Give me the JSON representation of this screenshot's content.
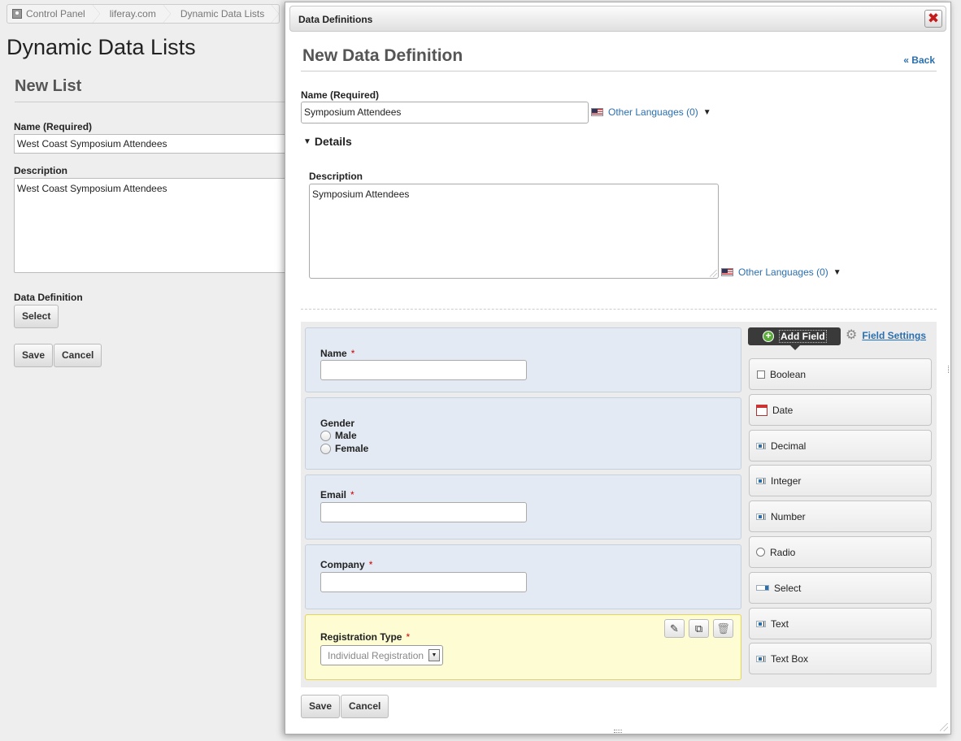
{
  "background": {
    "breadcrumb": [
      "Control Panel",
      "liferay.com",
      "Dynamic Data Lists"
    ],
    "page_title": "Dynamic Data Lists",
    "section_title": "New List",
    "name_label": "Name (Required)",
    "name_value": "West Coast Symposium Attendees",
    "description_label": "Description",
    "description_value": "West Coast Symposium Attendees",
    "data_definition_label": "Data Definition",
    "select_button": "Select",
    "save_button": "Save",
    "cancel_button": "Cancel"
  },
  "dialog": {
    "title": "Data Definitions",
    "close_icon": "✖",
    "heading": "New Data Definition",
    "back_link": "« Back",
    "name_label": "Name (Required)",
    "name_value": "Symposium Attendees",
    "other_languages": "Other Languages (0)",
    "details_toggle": "Details",
    "description_label": "Description",
    "description_value": "Symposium Attendees",
    "description_other_languages": "Other Languages (0)",
    "save_button": "Save",
    "cancel_button": "Cancel"
  },
  "builder": {
    "add_field_tab": "Add Field",
    "field_settings": "Field Settings",
    "fields": {
      "name": {
        "label": "Name",
        "required_mark": "*"
      },
      "gender": {
        "label": "Gender",
        "options": [
          "Male",
          "Female"
        ]
      },
      "email": {
        "label": "Email",
        "required_mark": "*"
      },
      "company": {
        "label": "Company",
        "required_mark": "*"
      },
      "registration_type": {
        "label": "Registration Type",
        "required_mark": "*",
        "selected_value": "Individual Registration"
      }
    },
    "palette": [
      {
        "label": "Boolean",
        "icon": "checkbox-icon"
      },
      {
        "label": "Date",
        "icon": "calendar-icon"
      },
      {
        "label": "Decimal",
        "icon": "text-field-icon"
      },
      {
        "label": "Integer",
        "icon": "text-field-icon"
      },
      {
        "label": "Number",
        "icon": "text-field-icon"
      },
      {
        "label": "Radio",
        "icon": "radio-icon"
      },
      {
        "label": "Select",
        "icon": "select-icon"
      },
      {
        "label": "Text",
        "icon": "text-field-icon"
      },
      {
        "label": "Text Box",
        "icon": "text-field-icon"
      }
    ]
  },
  "colors": {
    "link": "#2a6fb0",
    "field_box_bg": "#e3eaf3",
    "selected_field_bg": "#fdfcd3",
    "close_red": "#c51b1b"
  }
}
